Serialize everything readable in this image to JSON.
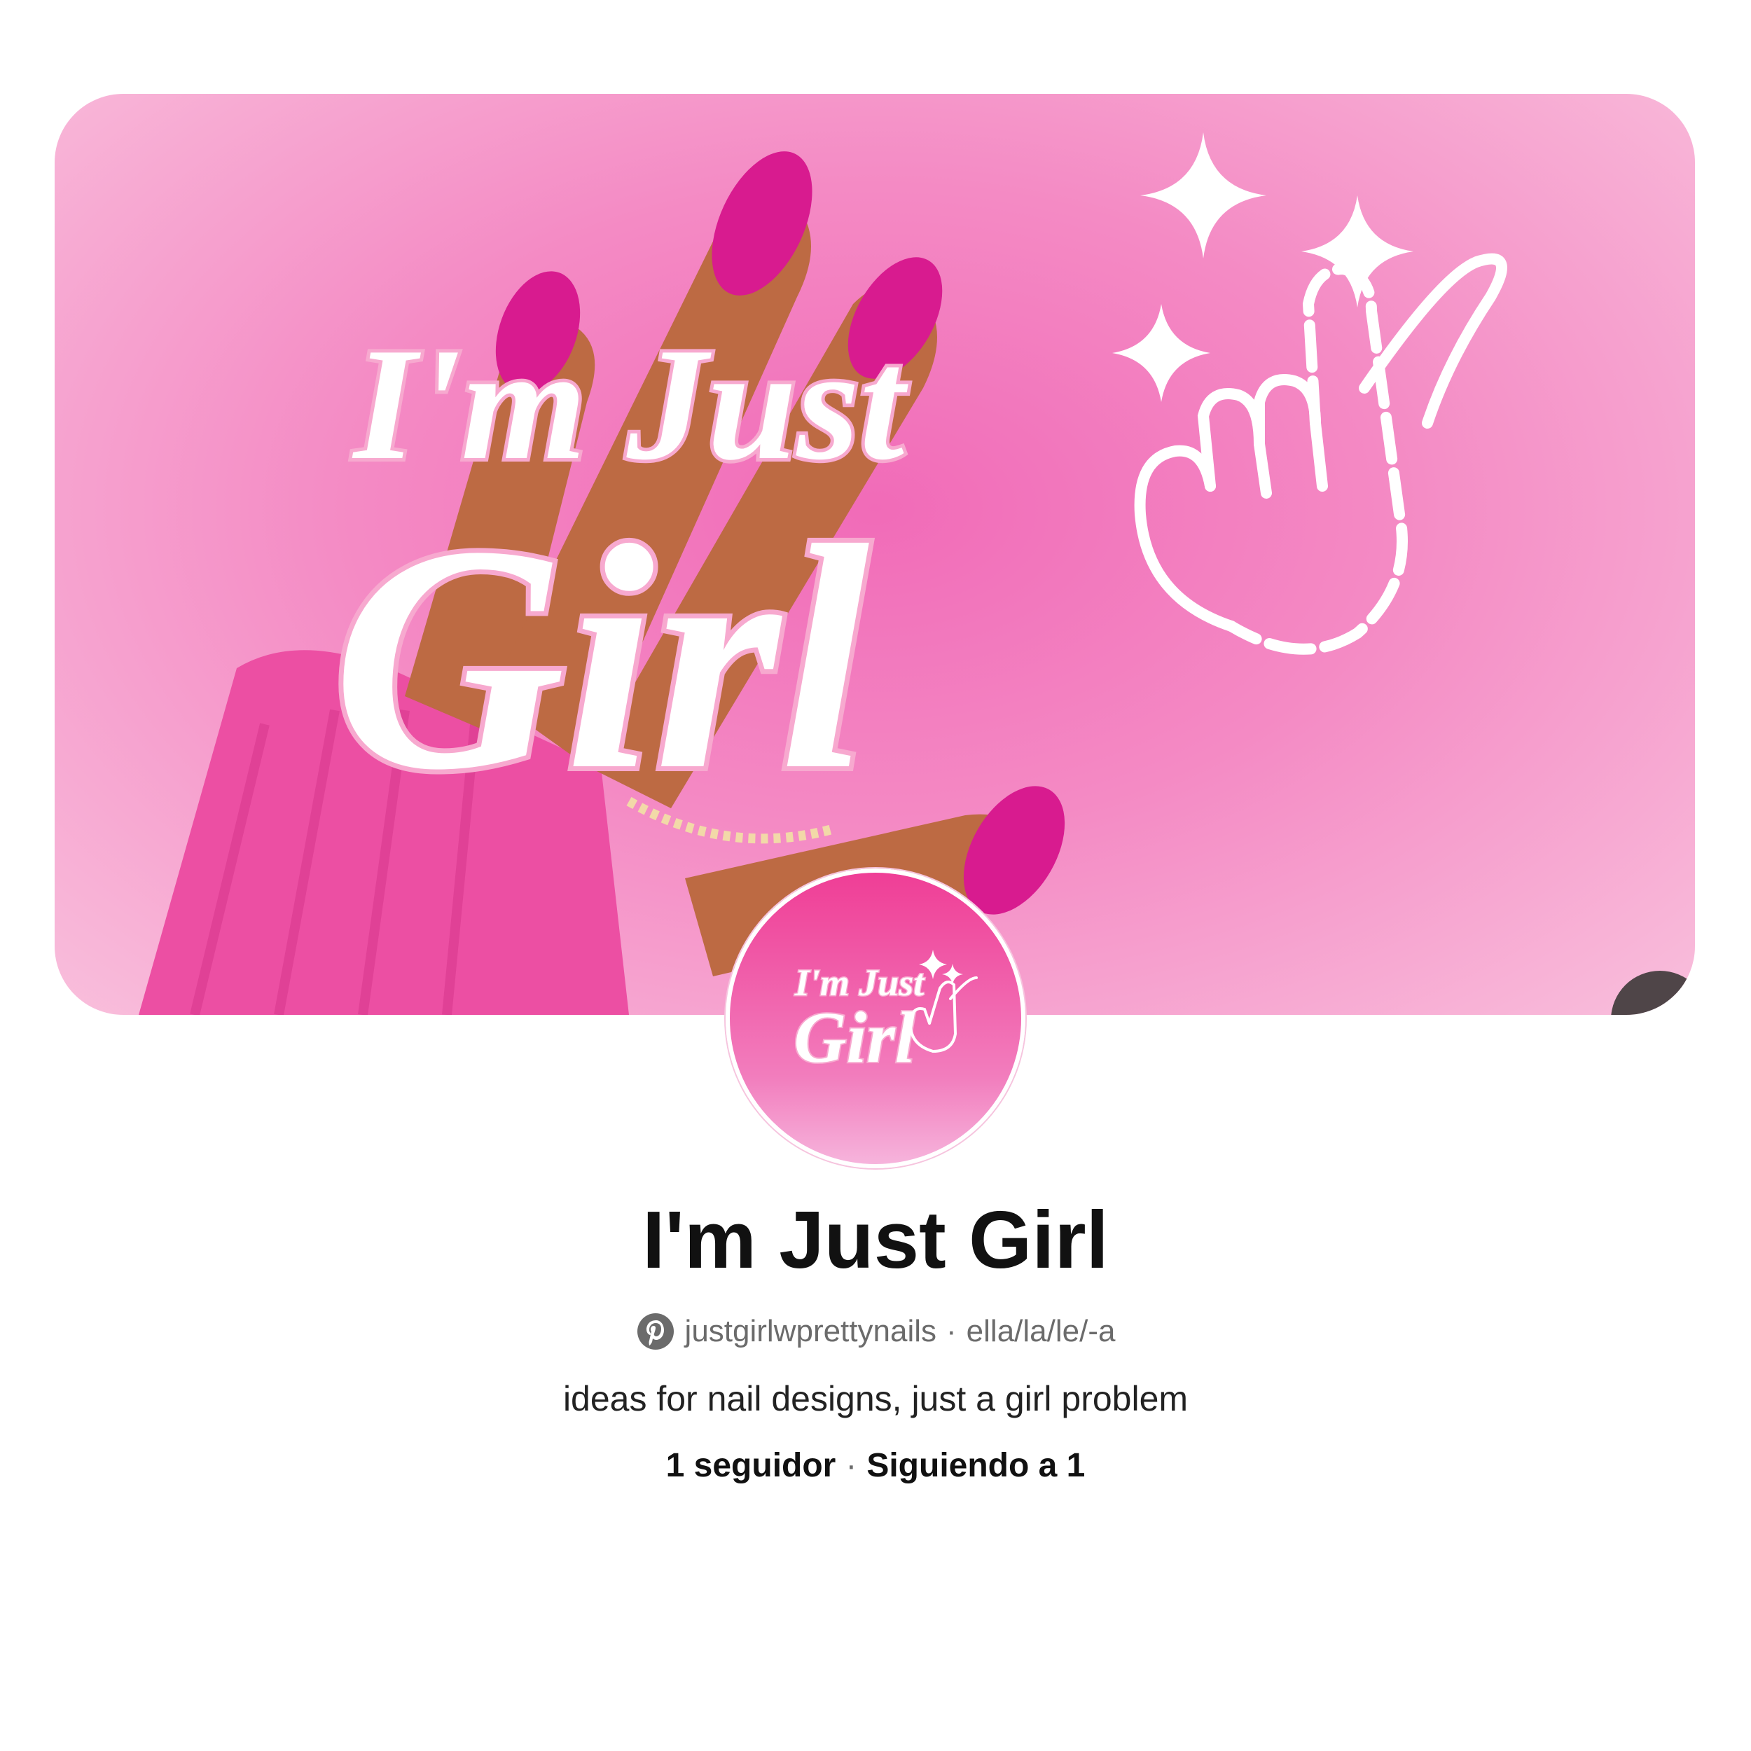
{
  "banner": {
    "logo_line1": "I'm Just",
    "logo_line2": "Girl",
    "edit_label": "pencil-icon"
  },
  "avatar": {
    "logo_line1": "I'm Just",
    "logo_line2": "Girl"
  },
  "profile": {
    "name": "I'm Just Girl",
    "handle": "justgirlwprettynails",
    "separator": "·",
    "pronouns": "ella/la/le/-a",
    "bio": "ideas for nail designs, just a girl problem",
    "followers": "1 seguidor",
    "following": "Siguiendo a 1"
  },
  "colors": {
    "accent_pink": "#f16bb8",
    "nail_magenta": "#d81b8f",
    "skin": "#b8643f",
    "edit_button_bg": "#4f4548"
  }
}
